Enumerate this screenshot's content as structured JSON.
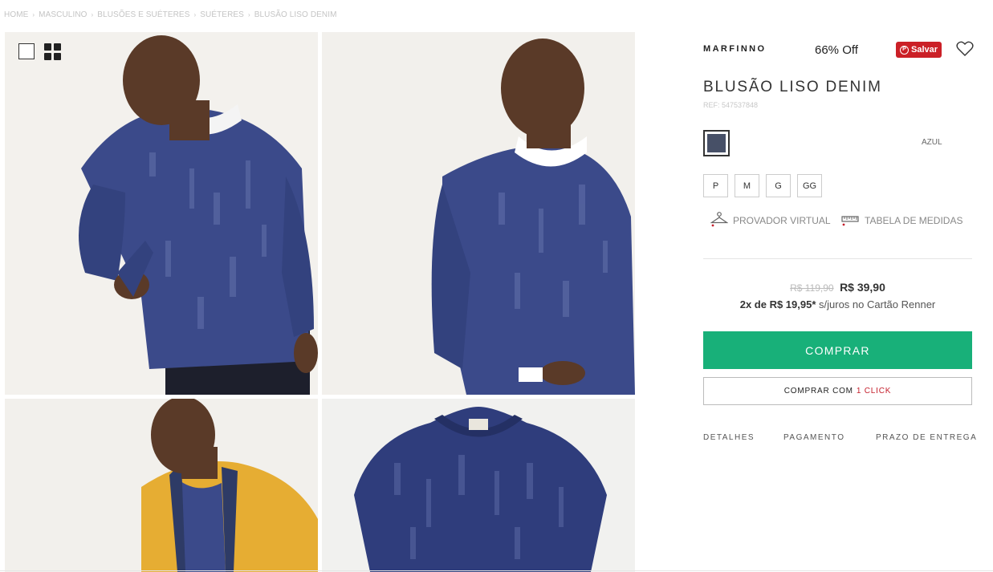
{
  "breadcrumb": {
    "items": [
      "HOME",
      "MASCULINO",
      "BLUSÕES E SUÉTERES",
      "SUÉTERES",
      "BLUSÃO LISO DENIM"
    ],
    "separator": "›"
  },
  "gallery": {
    "view_single_icon": "single-view-icon",
    "view_grid_icon": "grid-view-icon",
    "photos": [
      {
        "name": "model-front-sweater-photo"
      },
      {
        "name": "model-side-sweater-photo"
      },
      {
        "name": "model-yellow-jacket-photo"
      },
      {
        "name": "sweater-flat-photo"
      }
    ]
  },
  "product": {
    "brand": "MARFINNO",
    "discount": "66% Off",
    "save_label": "Salvar",
    "title": "BLUSÃO LISO DENIM",
    "ref": "REF: 547537848",
    "color": {
      "name": "AZUL",
      "swatch": "#475067"
    },
    "sizes": [
      "P",
      "M",
      "G",
      "GG"
    ],
    "tools": {
      "provador": "PROVADOR VIRTUAL",
      "medidas": "TABELA DE MEDIDAS"
    },
    "price": {
      "old": "R$ 119,90",
      "new": "R$ 39,90",
      "installments_bold": "2x de R$ 19,95*",
      "installments_rest": " s/juros no Cartão Renner"
    },
    "buy_label": "COMPRAR",
    "oneclick_label": "COMPRAR COM",
    "oneclick_highlight": "1 CLICK",
    "tabs": [
      "DETALHES",
      "PAGAMENTO",
      "PRAZO DE ENTREGA"
    ]
  },
  "colors": {
    "buy_button": "#18b079",
    "pinterest": "#cb2027",
    "accent_red": "#c41e2b",
    "sweater": "#3b4a8a"
  }
}
